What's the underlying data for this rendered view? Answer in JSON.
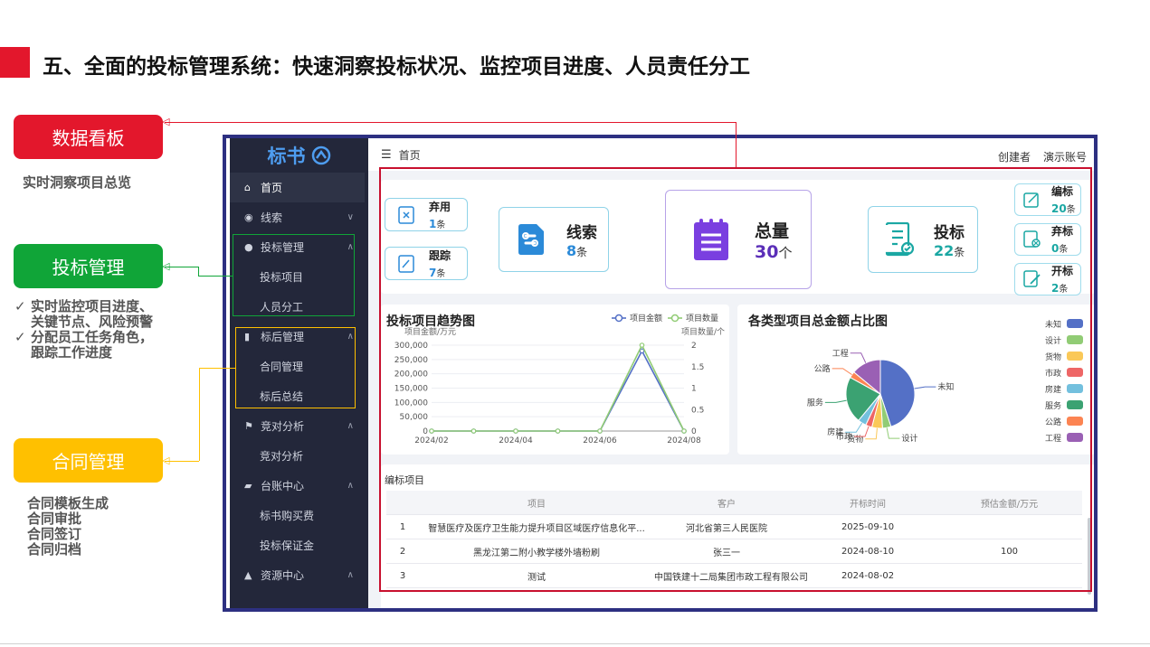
{
  "slide": {
    "title": "五、全面的投标管理系统：快速洞察投标状况、监控项目进度、人员责任分工",
    "callouts": [
      {
        "label": "数据看板",
        "color": "#e3172c"
      },
      {
        "label": "投标管理",
        "color": "#10a538"
      },
      {
        "label": "合同管理",
        "color": "#ffc000"
      }
    ],
    "note_dashboard": "实时洞察项目总览",
    "note_bid": [
      "实时监控项目进度、关键节点、风险预警",
      "分配员工任务角色，跟踪工作进度"
    ],
    "note_contract": [
      "合同模板生成",
      "合同审批",
      "合同签订",
      "合同归档"
    ]
  },
  "app": {
    "logo": "标书",
    "breadcrumb": "首页",
    "user_role": "创建者",
    "user_account": "演示账号",
    "menu": [
      {
        "label": "首页",
        "icon": "home-icon",
        "expand": ""
      },
      {
        "label": "线索",
        "icon": "pin-icon",
        "expand": "∨"
      },
      {
        "label": "投标管理",
        "icon": "user-icon",
        "expand": "∧"
      },
      {
        "label": "投标项目",
        "sub": true
      },
      {
        "label": "人员分工",
        "sub": true
      },
      {
        "label": "标后管理",
        "icon": "chart-icon",
        "expand": "∧"
      },
      {
        "label": "合同管理",
        "sub": true
      },
      {
        "label": "标后总结",
        "sub": true
      },
      {
        "label": "竞对分析",
        "icon": "flag-icon",
        "expand": "∧"
      },
      {
        "label": "竞对分析",
        "sub": true
      },
      {
        "label": "台账中心",
        "icon": "book-icon",
        "expand": "∧"
      },
      {
        "label": "标书购买费",
        "sub": true
      },
      {
        "label": "投标保证金",
        "sub": true
      },
      {
        "label": "资源中心",
        "icon": "folder-icon",
        "expand": "∧"
      }
    ]
  },
  "stats": {
    "abandon": {
      "label": "弃用",
      "value": "1",
      "unit": "条"
    },
    "follow": {
      "label": "跟踪",
      "value": "7",
      "unit": "条"
    },
    "leads": {
      "label": "线索",
      "value": "8",
      "unit": "条"
    },
    "total": {
      "label": "总量",
      "value": "30",
      "unit": "个"
    },
    "bids": {
      "label": "投标",
      "value": "22",
      "unit": "条"
    },
    "writing": {
      "label": "编标",
      "value": "20",
      "unit": "条"
    },
    "abandoned_bid": {
      "label": "弃标",
      "value": "0",
      "unit": "条"
    },
    "opening": {
      "label": "开标",
      "value": "2",
      "unit": "条"
    }
  },
  "chart_data": [
    {
      "type": "line",
      "title": "投标项目趋势图",
      "ylabel": "项目金额/万元",
      "y2label": "项目数量/个",
      "x": [
        "2024/02",
        "2024/03",
        "2024/04",
        "2024/05",
        "2024/06",
        "2024/07",
        "2024/08"
      ],
      "xticks": [
        "2024/02",
        "2024/04",
        "2024/06",
        "2024/08"
      ],
      "ylim": [
        0,
        300000
      ],
      "yticks": [
        "0",
        "50,000",
        "100,000",
        "150,000",
        "200,000",
        "250,000",
        "300,000"
      ],
      "y2lim": [
        0,
        2
      ],
      "y2ticks": [
        "0",
        "0.5",
        "1",
        "1.5",
        "2"
      ],
      "series": [
        {
          "name": "项目金额",
          "axis": "left",
          "color": "#5470c6",
          "values": [
            0,
            0,
            0,
            0,
            0,
            280000,
            0
          ]
        },
        {
          "name": "项目数量",
          "axis": "right",
          "color": "#91cc75",
          "values": [
            0,
            0,
            0,
            0,
            0,
            2,
            0
          ]
        }
      ],
      "legend": "top-right"
    },
    {
      "type": "pie",
      "title": "各类型项目总金额占比图",
      "categories": [
        "未知",
        "设计",
        "货物",
        "市政",
        "房建",
        "服务",
        "公路",
        "工程"
      ],
      "colors": [
        "#5470c6",
        "#91cc75",
        "#fac858",
        "#ee6666",
        "#73c0de",
        "#3ba272",
        "#fc8452",
        "#9a60b4"
      ],
      "values": [
        45,
        4,
        5,
        3,
        4,
        22,
        3,
        14
      ],
      "legend": "right"
    }
  ],
  "table": {
    "title": "编标项目",
    "columns": [
      "",
      "项目",
      "客户",
      "开标时间",
      "预估金额/万元"
    ],
    "rows": [
      [
        "1",
        "智慧医疗及医疗卫生能力提升项目区域医疗信息化平...",
        "河北省第三人民医院",
        "2025-09-10",
        ""
      ],
      [
        "2",
        "黑龙江第二附小教学楼外墙粉刷",
        "张三一",
        "2024-08-10",
        "100"
      ],
      [
        "3",
        "测试",
        "中国铁建十二局集团市政工程有限公司",
        "2024-08-02",
        ""
      ]
    ]
  }
}
